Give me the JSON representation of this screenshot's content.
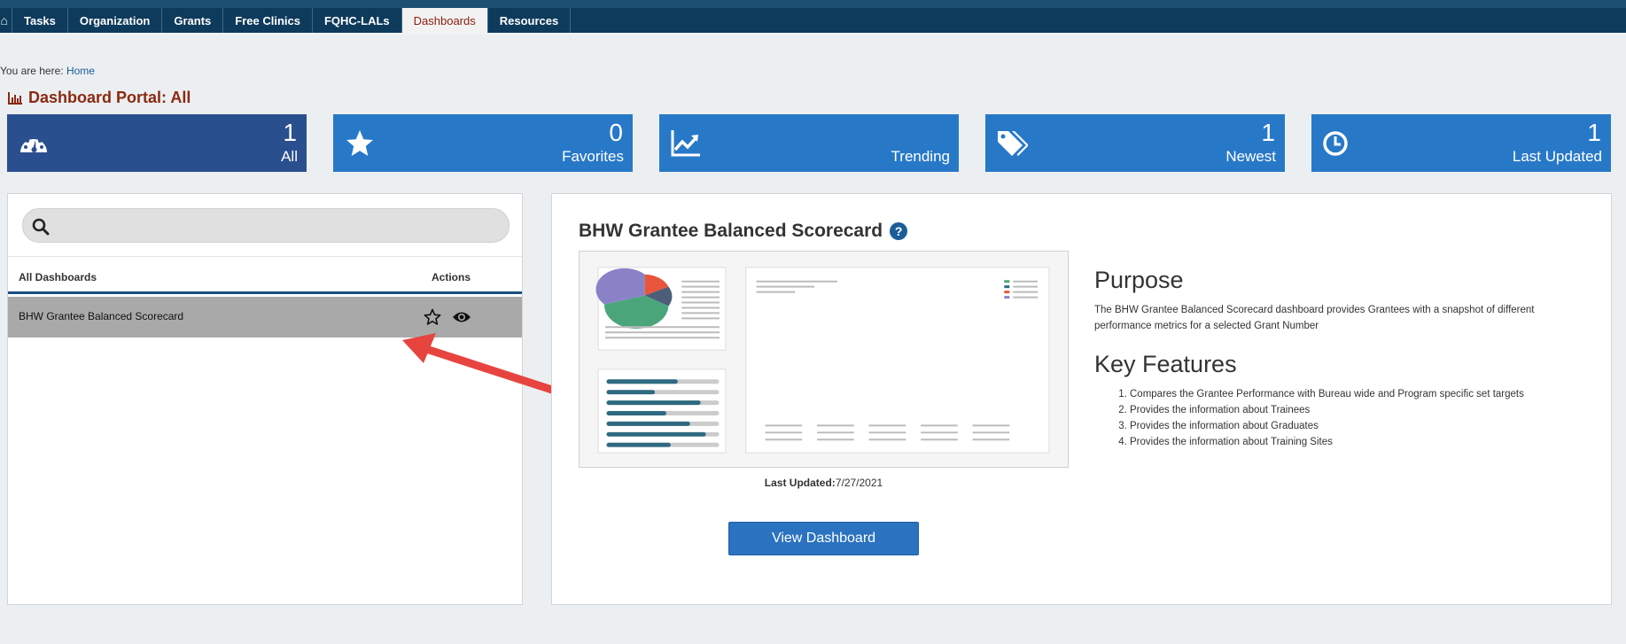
{
  "nav": {
    "home_icon": "home-icon",
    "items": [
      "Tasks",
      "Organization",
      "Grants",
      "Free Clinics",
      "FQHC-LALs",
      "Dashboards",
      "Resources"
    ],
    "active": "Dashboards"
  },
  "breadcrumb": {
    "prefix": "You are here: ",
    "home": "Home"
  },
  "page_title": "Dashboard Portal: All",
  "tiles": [
    {
      "count": "1",
      "label": "All",
      "icon": "dashboard-gauge-icon",
      "color": "#2a4f8f"
    },
    {
      "count": "0",
      "label": "Favorites",
      "icon": "star-icon",
      "color": "#2878c8"
    },
    {
      "count": "",
      "label": "Trending",
      "icon": "trending-icon",
      "color": "#2878c8"
    },
    {
      "count": "1",
      "label": "Newest",
      "icon": "tags-icon",
      "color": "#2878c8"
    },
    {
      "count": "1",
      "label": "Last Updated",
      "icon": "clock-icon",
      "color": "#2878c8"
    }
  ],
  "search": {
    "placeholder": ""
  },
  "list": {
    "col_dashboards": "All Dashboards",
    "col_actions": "Actions",
    "rows": [
      {
        "name": "BHW Grantee Balanced Scorecard"
      }
    ]
  },
  "detail": {
    "title": "BHW Grantee Balanced Scorecard",
    "last_updated_label": "Last Updated:",
    "last_updated_value": "7/27/2021",
    "view_button": "View Dashboard",
    "purpose_heading": "Purpose",
    "purpose_text": "The BHW Grantee Balanced Scorecard dashboard provides Grantees with a snapshot of different performance metrics for a selected Grant Number",
    "features_heading": "Key Features",
    "features": [
      "Compares the Grantee Performance with Bureau wide and Program specific set targets",
      "Provides the information about Trainees",
      "Provides the information about Graduates",
      "Provides the information about Training Sites"
    ]
  },
  "colors": {
    "navbar": "#0e3a5c",
    "tile": "#2878c8",
    "tile_active": "#2a4f8f",
    "title": "#8a2a10",
    "button": "#2b72c0",
    "arrow": "#e8443f"
  }
}
